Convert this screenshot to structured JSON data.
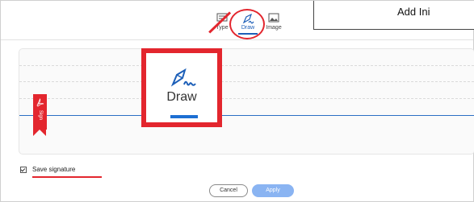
{
  "tabs": [
    {
      "label": "Type",
      "icon": "keyboard-icon"
    },
    {
      "label": "Draw",
      "icon": "pen-icon",
      "active": true
    },
    {
      "label": "Image",
      "icon": "image-icon"
    }
  ],
  "callout_topright": {
    "text": "Add Ini"
  },
  "sign_flag": {
    "text": "Sign"
  },
  "draw_callout": {
    "label": "Draw",
    "icon": "pen-icon"
  },
  "save_signature": {
    "label": "Save signature",
    "checked": true
  },
  "buttons": {
    "cancel": "Cancel",
    "apply": "Apply"
  },
  "colors": {
    "accent": "#1d5fb8",
    "highlight": "#e3262e",
    "apply_disabled": "#8ab4f2"
  }
}
